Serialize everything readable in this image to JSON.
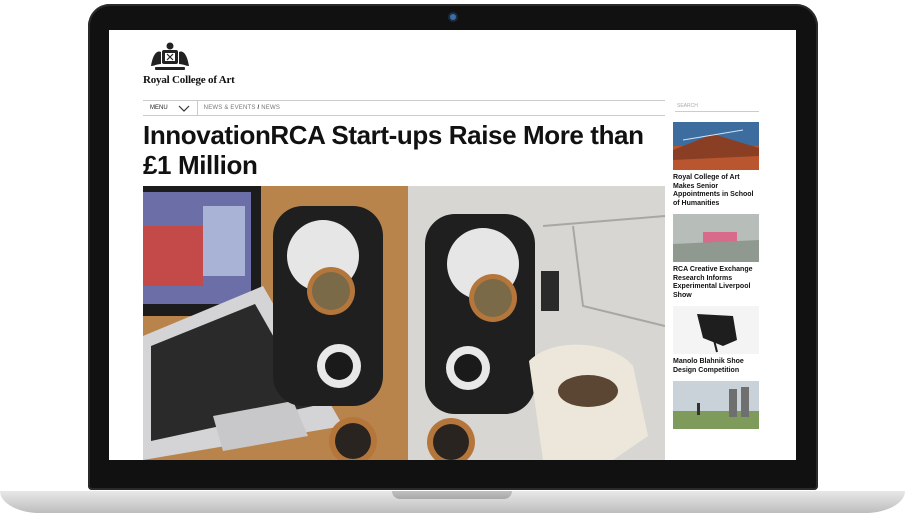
{
  "site": {
    "name": "Royal College of Art"
  },
  "nav": {
    "menu_label": "MENU",
    "crumb_1": "NEWS & EVENTS",
    "crumb_sep": "/",
    "crumb_2": "NEWS"
  },
  "search": {
    "placeholder": "SEARCH"
  },
  "article": {
    "title": "InnovationRCA Start-ups Raise More than £1 Million"
  },
  "sidebar": {
    "items": [
      {
        "title": "Royal College of Art Makes Senior Appointments in School of Humanities"
      },
      {
        "title": "RCA Creative Exchange Research Informs Experimental Liverpool Show"
      },
      {
        "title": "Manolo Blahnik Shoe Design Competition"
      },
      {
        "title": ""
      }
    ]
  },
  "colors": {
    "text": "#111111",
    "divider": "#cccccc",
    "bezel": "#111111"
  },
  "icons": {
    "menu": "chevron-down-icon",
    "crest": "crest-icon",
    "camera": "camera-icon"
  }
}
